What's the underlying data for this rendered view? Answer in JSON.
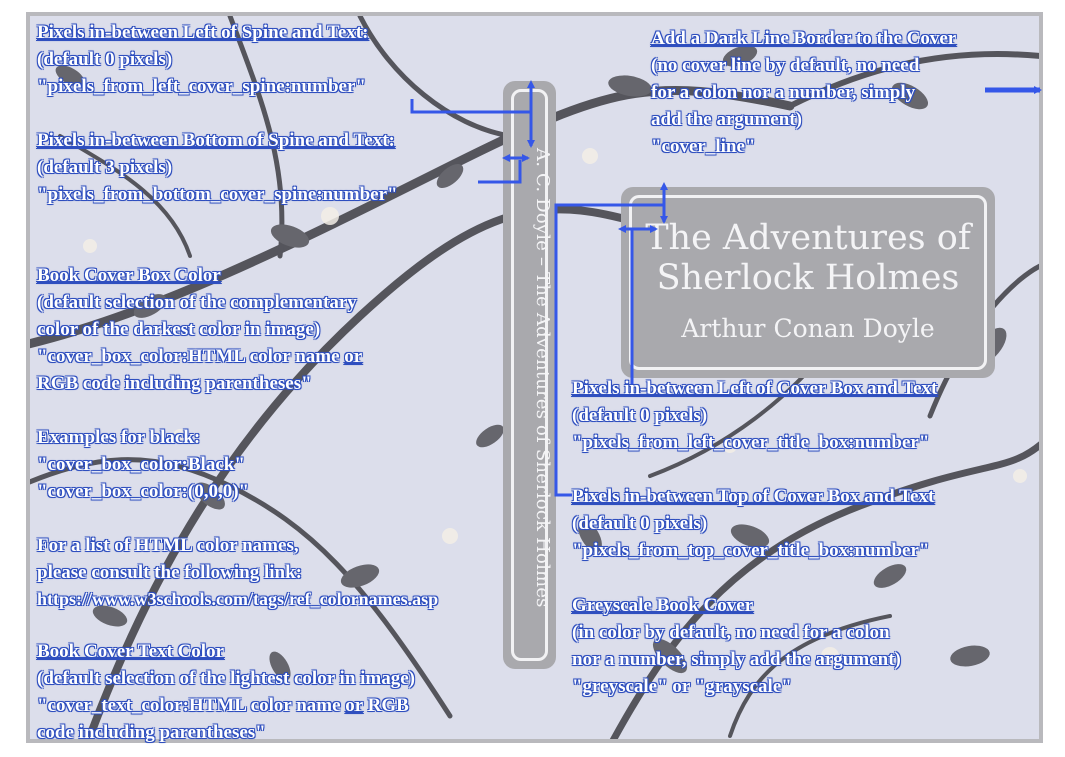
{
  "spine": {
    "text": "A. C. Doyle – The Adventures of Sherlock Holmes"
  },
  "cover": {
    "title_line1": "The Adventures of",
    "title_line2": "Sherlock Holmes",
    "author": "Arthur Conan Doyle"
  },
  "annotations": {
    "spine_left": {
      "heading": "Pixels in-between Left of Spine and Text:",
      "default": "(default 0 pixels)",
      "arg": "\"pixels_from_left_cover_spine:number\""
    },
    "spine_bottom": {
      "heading": "Pixels in-between Bottom of Spine and Text:",
      "default": "(default 3 pixels)",
      "arg": "\"pixels_from_bottom_cover_spine:number\""
    },
    "box_color": {
      "heading": "Book Cover Box Color",
      "line1": "(default selection of the complementary",
      "line2": "color of the darkest color in image)",
      "line3a": "\"cover_box_color:HTML color name ",
      "or": "or",
      "line4": "RGB code including parentheses\""
    },
    "examples": {
      "heading": "Examples for black:",
      "ex1": "\"cover_box_color:Black\"",
      "ex2": "\"cover_box_color:(0,0,0)\""
    },
    "colornames": {
      "line1": "For a list of HTML color names,",
      "line2": "please consult the following link:",
      "link": "https://www.w3schools.com/tags/ref_colornames.asp"
    },
    "text_color": {
      "heading": "Book Cover Text Color",
      "line1": "(default selection of the lightest color in image)",
      "line2a": "\"cover_text_color:HTML color name ",
      "or": "or",
      "line2b": " RGB",
      "line3": "code including parentheses\""
    },
    "cover_line": {
      "heading": "Add a Dark Line Border to the Cover",
      "line1": "(no cover line by default, no need",
      "line2": "for a colon nor a number, simply",
      "line3": "add the argument)",
      "arg": "\"cover_line\""
    },
    "box_left": {
      "heading": "Pixels in-between Left of Cover Box and Text",
      "default": "(default 0 pixels)",
      "arg": "\"pixels_from_left_cover_title_box:number\""
    },
    "box_top": {
      "heading": "Pixels in-between Top of Cover Box and Text",
      "default": "(default 0 pixels)",
      "arg": "\"pixels_from_top_cover_title_box:number\""
    },
    "greyscale": {
      "heading": "Greyscale Book Cover",
      "line1": "(in color by default, no need for a colon",
      "line2": "nor a number, simply add the argument)",
      "arg": "\"greyscale\" or \"grayscale\""
    }
  },
  "colors": {
    "annotation_blue": "#2f4fbf",
    "arrow_blue": "#3557e8",
    "box_grey": "#a9a9ad",
    "background": "#dcdeeb"
  }
}
